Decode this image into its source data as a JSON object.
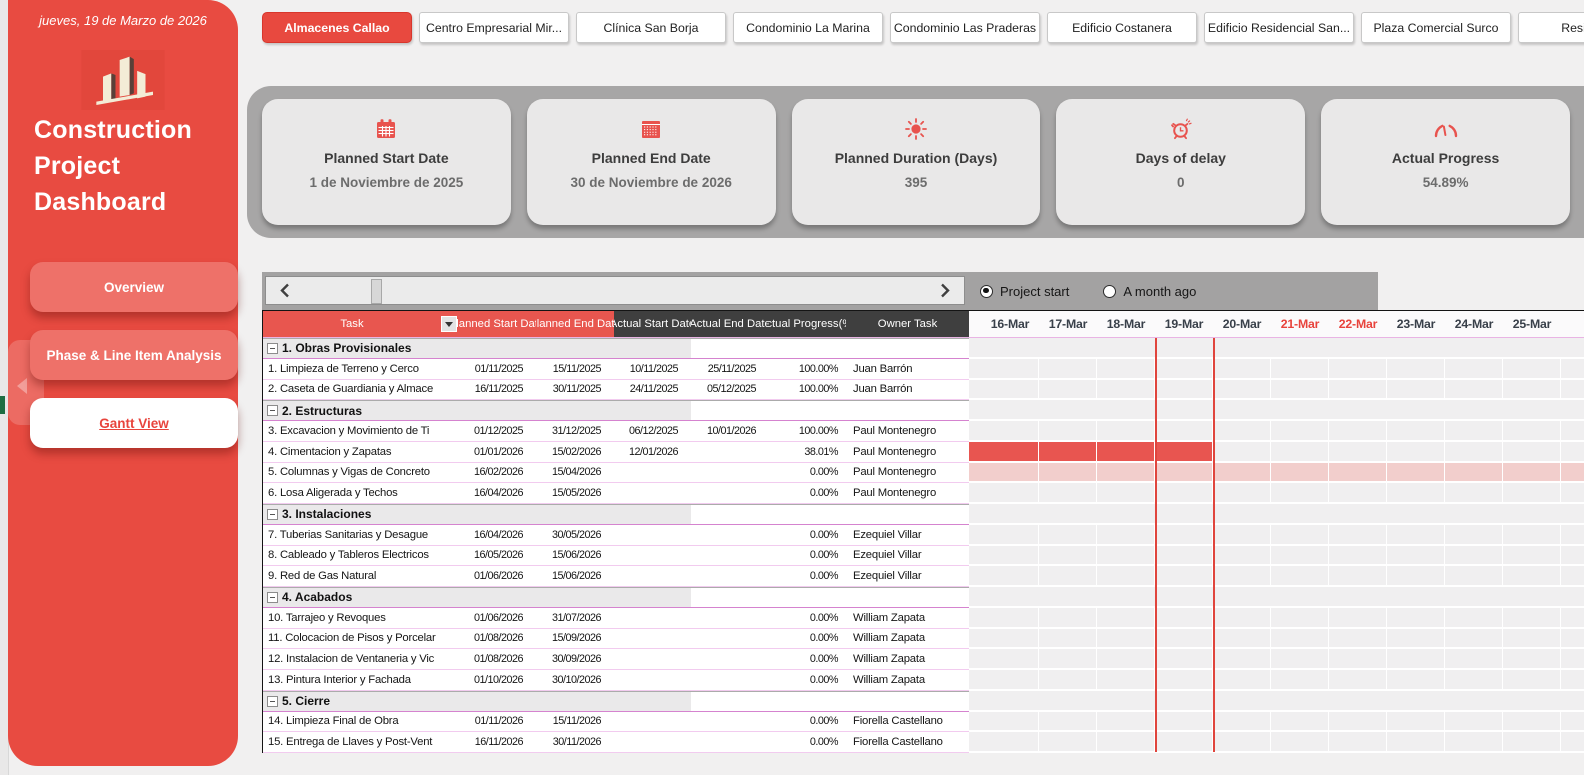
{
  "colors": {
    "accent_red": "#e8493f",
    "nav_button_red": "#ee7169",
    "header_dark": "#3f3f3f",
    "band_gray": "#a7a6a6",
    "gantt_cell": "#f0eff0",
    "bar_solid": "#e85550",
    "bar_light": "#f2cecc",
    "weekend_red": "#e8433c",
    "group_separator_pink": "#d583cf"
  },
  "sidebar": {
    "date": "jueves, 19 de Marzo de 2026",
    "logo": "buildings-logo",
    "title": "Construction Project Dashboard",
    "nav": [
      {
        "label": "Overview",
        "active": false
      },
      {
        "label": "Phase & Line Item Analysis",
        "active": false
      },
      {
        "label": "Gantt View",
        "active": true
      }
    ]
  },
  "tabs": [
    {
      "label": "Almacenes Callao",
      "selected": true
    },
    {
      "label": "Centro Empresarial Mir...",
      "selected": false
    },
    {
      "label": "Clínica San Borja",
      "selected": false
    },
    {
      "label": "Condominio La Marina",
      "selected": false
    },
    {
      "label": "Condominio Las Praderas",
      "selected": false
    },
    {
      "label": "Edificio Costanera",
      "selected": false
    },
    {
      "label": "Edificio Residencial San...",
      "selected": false
    },
    {
      "label": "Plaza Comercial Surco",
      "selected": false
    },
    {
      "label": "Residencial",
      "selected": false
    }
  ],
  "kpis": [
    {
      "icon": "calendar-start-icon",
      "title": "Planned Start Date",
      "value": "1 de Noviembre de 2025"
    },
    {
      "icon": "calendar-end-icon",
      "title": "Planned End Date",
      "value": "30 de Noviembre de 2026"
    },
    {
      "icon": "sun-icon",
      "title": "Planned Duration (Days)",
      "value": "395"
    },
    {
      "icon": "alarm-clock-icon",
      "title": "Days of delay",
      "value": "0"
    },
    {
      "icon": "gauge-icon",
      "title": "Actual Progress",
      "value": "54.89%"
    }
  ],
  "controls": {
    "scrollbar": {
      "left_arrow": "‹",
      "right_arrow": "›"
    },
    "view_options": [
      {
        "label": "Project start",
        "selected": true
      },
      {
        "label": "A month ago",
        "selected": false
      }
    ]
  },
  "table": {
    "headers": {
      "task": "Task",
      "planned_start": "Planned Start Date",
      "planned_end": "Planned End Date",
      "actual_start": "Actual Start Date",
      "actual_end": "Actual End Date",
      "actual_progress": "Actual Progress(%)",
      "owner": "Owner Task"
    },
    "rows": [
      {
        "type": "group",
        "name": "1. Obras Provisionales"
      },
      {
        "type": "task",
        "name": "1. Limpieza de Terreno y Cerco",
        "planned_start": "01/11/2025",
        "planned_end": "15/11/2025",
        "actual_start": "10/11/2025",
        "actual_end": "25/11/2025",
        "progress": "100.00%",
        "owner": "Juan Barrón",
        "gantt_bar": ""
      },
      {
        "type": "task",
        "name": "2. Caseta de Guardiania y Almace",
        "planned_start": "16/11/2025",
        "planned_end": "30/11/2025",
        "actual_start": "24/11/2025",
        "actual_end": "05/12/2025",
        "progress": "100.00%",
        "owner": "Juan Barrón",
        "gantt_bar": ""
      },
      {
        "type": "group",
        "name": "2. Estructuras"
      },
      {
        "type": "task",
        "name": "3. Excavacion y Movimiento de Ti",
        "planned_start": "01/12/2025",
        "planned_end": "31/12/2025",
        "actual_start": "06/12/2025",
        "actual_end": "10/01/2026",
        "progress": "100.00%",
        "owner": "Paul Montenegro",
        "gantt_bar": ""
      },
      {
        "type": "task",
        "name": "4. Cimentacion y Zapatas",
        "planned_start": "01/01/2026",
        "planned_end": "15/02/2026",
        "actual_start": "12/01/2026",
        "actual_end": "",
        "progress": "38.01%",
        "owner": "Paul Montenegro",
        "gantt_bar": "solid"
      },
      {
        "type": "task",
        "name": "5. Columnas y Vigas de Concreto",
        "planned_start": "16/02/2026",
        "planned_end": "15/04/2026",
        "actual_start": "",
        "actual_end": "",
        "progress": "0.00%",
        "owner": "Paul Montenegro",
        "gantt_bar": "light"
      },
      {
        "type": "task",
        "name": "6. Losa Aligerada y Techos",
        "planned_start": "16/04/2026",
        "planned_end": "15/05/2026",
        "actual_start": "",
        "actual_end": "",
        "progress": "0.00%",
        "owner": "Paul Montenegro",
        "gantt_bar": ""
      },
      {
        "type": "group",
        "name": "3. Instalaciones"
      },
      {
        "type": "task",
        "name": "7. Tuberias Sanitarias y Desague",
        "planned_start": "16/04/2026",
        "planned_end": "30/05/2026",
        "actual_start": "",
        "actual_end": "",
        "progress": "0.00%",
        "owner": "Ezequiel Villar",
        "gantt_bar": ""
      },
      {
        "type": "task",
        "name": "8. Cableado y Tableros Electricos",
        "planned_start": "16/05/2026",
        "planned_end": "15/06/2026",
        "actual_start": "",
        "actual_end": "",
        "progress": "0.00%",
        "owner": "Ezequiel Villar",
        "gantt_bar": ""
      },
      {
        "type": "task",
        "name": "9. Red de Gas Natural",
        "planned_start": "01/06/2026",
        "planned_end": "15/06/2026",
        "actual_start": "",
        "actual_end": "",
        "progress": "0.00%",
        "owner": "Ezequiel Villar",
        "gantt_bar": ""
      },
      {
        "type": "group",
        "name": "4. Acabados"
      },
      {
        "type": "task",
        "name": "10. Tarrajeo y Revoques",
        "planned_start": "01/06/2026",
        "planned_end": "31/07/2026",
        "actual_start": "",
        "actual_end": "",
        "progress": "0.00%",
        "owner": "William Zapata",
        "gantt_bar": ""
      },
      {
        "type": "task",
        "name": "11. Colocacion de Pisos y Porcelar",
        "planned_start": "01/08/2026",
        "planned_end": "15/09/2026",
        "actual_start": "",
        "actual_end": "",
        "progress": "0.00%",
        "owner": "William Zapata",
        "gantt_bar": ""
      },
      {
        "type": "task",
        "name": "12. Instalacion de Ventaneria y Vic",
        "planned_start": "01/08/2026",
        "planned_end": "30/09/2026",
        "actual_start": "",
        "actual_end": "",
        "progress": "0.00%",
        "owner": "William Zapata",
        "gantt_bar": ""
      },
      {
        "type": "task",
        "name": "13. Pintura Interior y Fachada",
        "planned_start": "01/10/2026",
        "planned_end": "30/10/2026",
        "actual_start": "",
        "actual_end": "",
        "progress": "0.00%",
        "owner": "William Zapata",
        "gantt_bar": ""
      },
      {
        "type": "group",
        "name": "5. Cierre"
      },
      {
        "type": "task",
        "name": "14. Limpieza Final de Obra",
        "planned_start": "01/11/2026",
        "planned_end": "15/11/2026",
        "actual_start": "",
        "actual_end": "",
        "progress": "0.00%",
        "owner": "Fiorella Castellano",
        "gantt_bar": ""
      },
      {
        "type": "task",
        "name": "15. Entrega de Llaves y Post-Vent",
        "planned_start": "16/11/2026",
        "planned_end": "30/11/2026",
        "actual_start": "",
        "actual_end": "",
        "progress": "0.00%",
        "owner": "Fiorella Castellano",
        "gantt_bar": ""
      }
    ]
  },
  "gantt": {
    "day_labels": [
      {
        "label": "16-Mar",
        "weekend": false
      },
      {
        "label": "17-Mar",
        "weekend": false
      },
      {
        "label": "18-Mar",
        "weekend": false
      },
      {
        "label": "19-Mar",
        "weekend": false
      },
      {
        "label": "20-Mar",
        "weekend": false
      },
      {
        "label": "21-Mar",
        "weekend": true
      },
      {
        "label": "22-Mar",
        "weekend": true
      },
      {
        "label": "23-Mar",
        "weekend": false
      },
      {
        "label": "24-Mar",
        "weekend": false
      },
      {
        "label": "25-Mar",
        "weekend": false
      }
    ],
    "today_label": "19-Mar",
    "bars": [
      {
        "task": "4. Cimentacion y Zapatas",
        "style": "solid",
        "start": "before 16-Mar",
        "end": "19-Mar"
      },
      {
        "task": "5. Columnas y Vigas de Concreto",
        "style": "light",
        "start": "before 16-Mar",
        "end": "after 25-Mar"
      }
    ]
  }
}
